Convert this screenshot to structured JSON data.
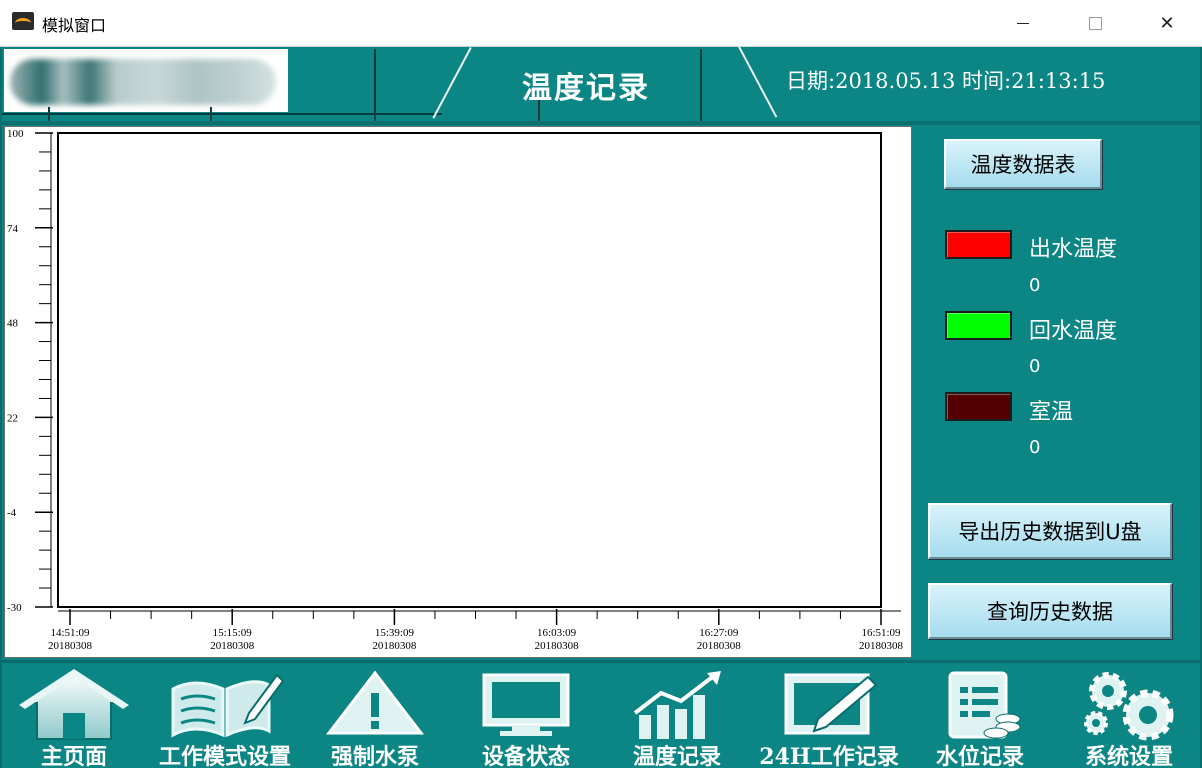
{
  "window": {
    "title": "模拟窗口",
    "icon": "app-icon",
    "controls": {
      "close_glyph": "✕"
    }
  },
  "header": {
    "title": "温度记录",
    "date_label": "日期:",
    "date": "2018.05.13",
    "time_label": "时间:",
    "time": "21:13:15"
  },
  "chart_data": {
    "type": "line",
    "y_ticks": [
      "100",
      "74",
      "48",
      "22",
      "-4",
      "-30"
    ],
    "y_tick_values": [
      100,
      74,
      48,
      22,
      -4,
      -30
    ],
    "ylim": [
      -30,
      100
    ],
    "x_ticks": [
      {
        "time": "14:51:09",
        "date": "20180308"
      },
      {
        "time": "15:15:09",
        "date": "20180308"
      },
      {
        "time": "15:39:09",
        "date": "20180308"
      },
      {
        "time": "16:03:09",
        "date": "20180308"
      },
      {
        "time": "16:27:09",
        "date": "20180308"
      },
      {
        "time": "16:51:09",
        "date": "20180308"
      }
    ],
    "series": [
      {
        "name": "出水温度",
        "color": "#ff0000",
        "values": []
      },
      {
        "name": "回水温度",
        "color": "#00ff00",
        "values": []
      },
      {
        "name": "室温",
        "color": "#550000",
        "values": []
      }
    ],
    "grid": false
  },
  "side": {
    "table_button": "温度数据表",
    "legend": [
      {
        "label": "出水温度",
        "value": "0",
        "color": "#ff0000"
      },
      {
        "label": "回水温度",
        "value": "0",
        "color": "#00ff00"
      },
      {
        "label": "室温",
        "value": "0",
        "color": "#550000"
      }
    ],
    "export_button": "导出历史数据到U盘",
    "query_button": "查询历史数据"
  },
  "nav": [
    {
      "label": "主页面",
      "icon": "home-icon"
    },
    {
      "label": "工作模式设置",
      "icon": "book-pencil-icon"
    },
    {
      "label": "强制水泵",
      "icon": "warning-icon"
    },
    {
      "label": "设备状态",
      "icon": "monitor-icon"
    },
    {
      "label": "温度记录",
      "icon": "bar-chart-icon"
    },
    {
      "label": "24H工作记录",
      "icon": "edit-board-icon"
    },
    {
      "label": "水位记录",
      "icon": "document-coins-icon"
    },
    {
      "label": "系统设置",
      "icon": "gears-icon"
    }
  ]
}
